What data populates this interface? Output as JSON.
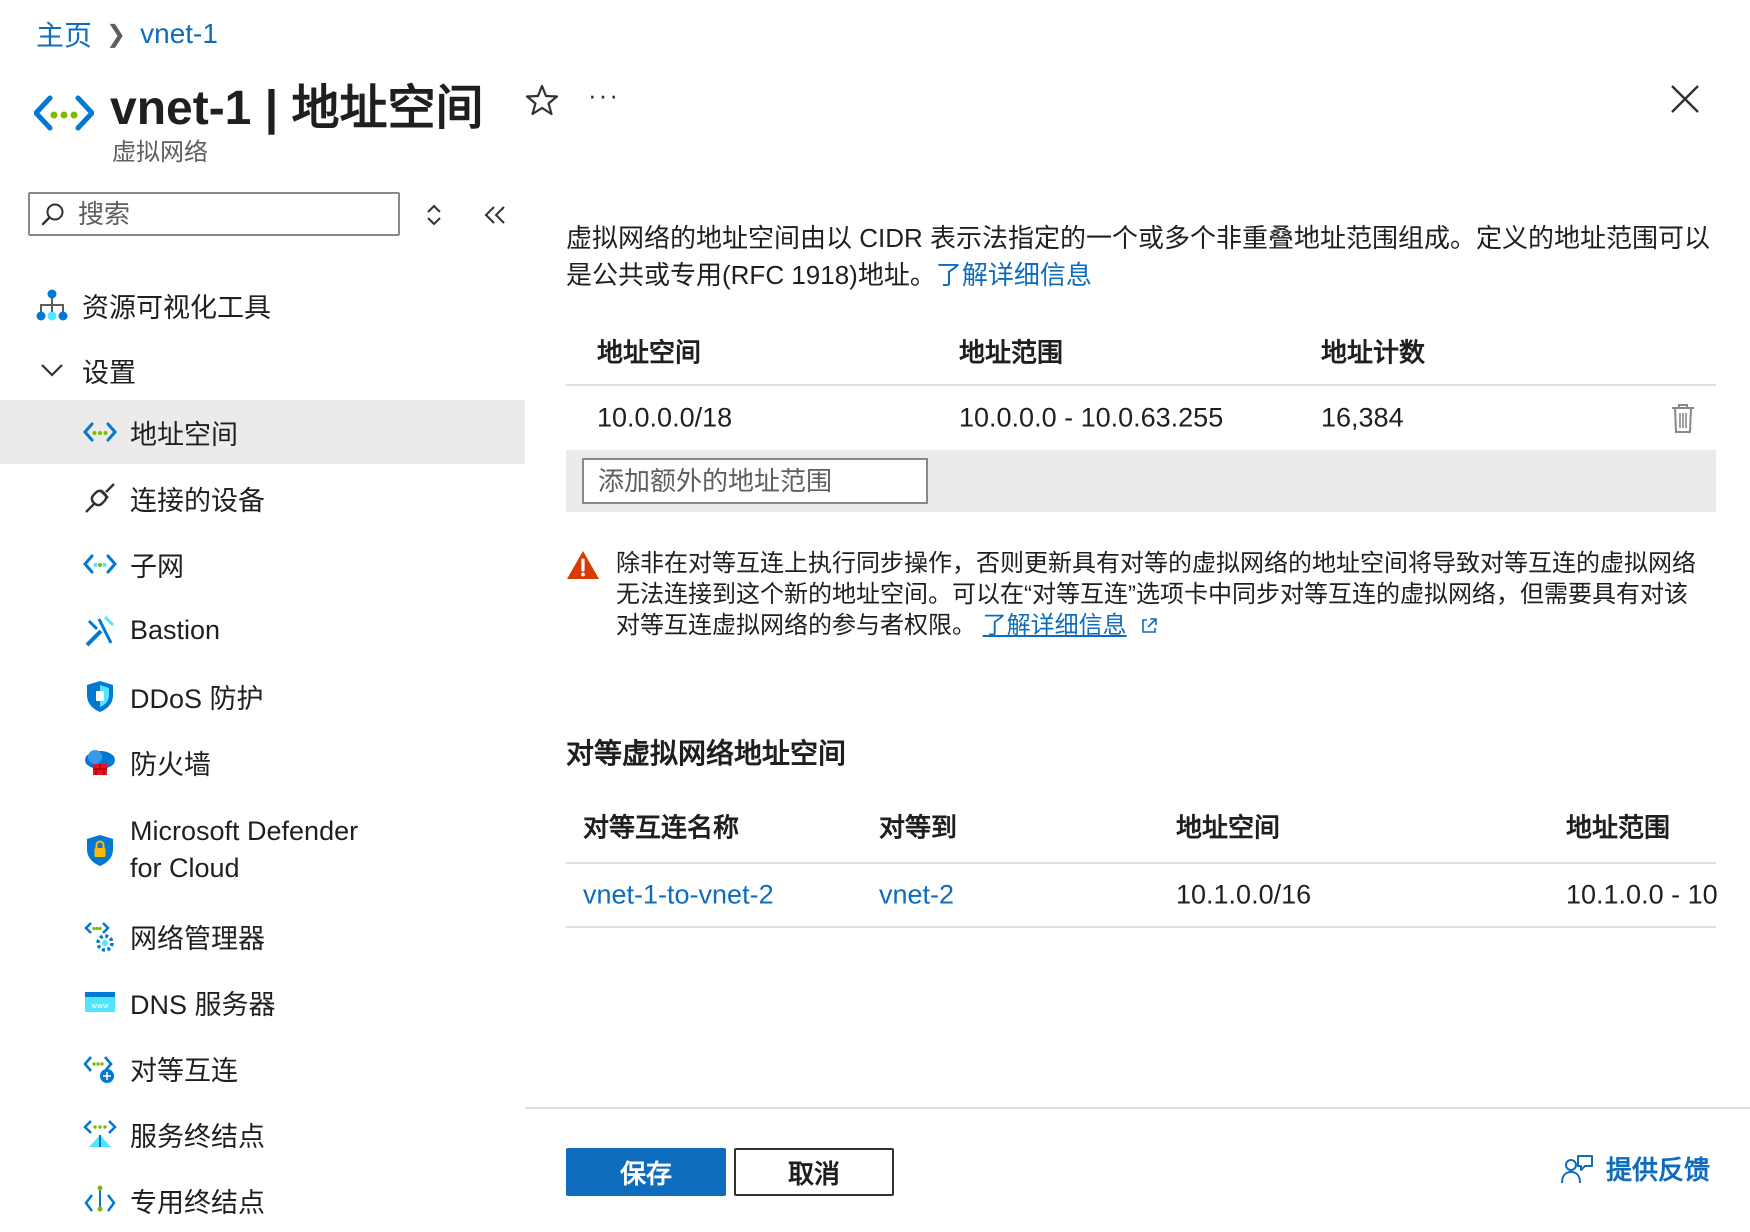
{
  "breadcrumb": {
    "home": "主页",
    "current": "vnet-1"
  },
  "header": {
    "title": "vnet-1 | 地址空间",
    "subtitle": "虚拟网络",
    "more_label": "···"
  },
  "sidebar": {
    "search_placeholder": "搜索",
    "items": [
      {
        "label": "资源可视化工具",
        "icon": "resource-visualizer-icon"
      },
      {
        "label": "设置",
        "icon": "chevron-down-icon"
      },
      {
        "label": "地址空间",
        "icon": "address-space-icon",
        "selected": true
      },
      {
        "label": "连接的设备",
        "icon": "plug-icon"
      },
      {
        "label": "子网",
        "icon": "subnet-icon"
      },
      {
        "label": "Bastion",
        "icon": "bastion-icon"
      },
      {
        "label": "DDoS 防护",
        "icon": "shield-icon"
      },
      {
        "label": "防火墙",
        "icon": "firewall-icon"
      },
      {
        "label_line1": "Microsoft Defender",
        "label_line2": "for Cloud",
        "icon": "defender-shield-icon"
      },
      {
        "label": "网络管理器",
        "icon": "network-manager-icon"
      },
      {
        "label": "DNS 服务器",
        "icon": "dns-icon"
      },
      {
        "label": "对等互连",
        "icon": "peering-icon"
      },
      {
        "label": "服务终结点",
        "icon": "service-endpoint-icon"
      },
      {
        "label": "专用终结点",
        "icon": "private-endpoint-icon"
      }
    ]
  },
  "main": {
    "intro_text": "虚拟网络的地址空间由以 CIDR 表示法指定的一个或多个非重叠地址范围组成。定义的地址范围可以是公共或专用(RFC 1918)地址。",
    "intro_link": "了解详细信息",
    "address_table": {
      "headers": [
        "地址空间",
        "地址范围",
        "地址计数"
      ],
      "rows": [
        {
          "space": "10.0.0.0/18",
          "range": "10.0.0.0 - 10.0.63.255",
          "count": "16,384"
        }
      ],
      "add_placeholder": "添加额外的地址范围"
    },
    "warning": {
      "text": "除非在对等互连上执行同步操作，否则更新具有对等的虚拟网络的地址空间将导致对等互连的虚拟网络无法连接到这个新的地址空间。可以在“对等互连”选项卡中同步对等互连的虚拟网络，但需要具有对该对等互连虚拟网络的参与者权限。",
      "link": "了解详细信息"
    },
    "peered_section_title": "对等虚拟网络地址空间",
    "peered_table": {
      "headers": [
        "对等互连名称",
        "对等到",
        "地址空间",
        "地址范围"
      ],
      "rows": [
        {
          "name": "vnet-1-to-vnet-2",
          "peer": "vnet-2",
          "space": "10.1.0.0/16",
          "range": "10.1.0.0 - 10"
        }
      ]
    }
  },
  "footer": {
    "save_label": "保存",
    "cancel_label": "取消",
    "feedback_label": "提供反馈"
  },
  "colors": {
    "accent": "#0f6cbd",
    "selected_bg": "#edebe9",
    "warning": "#d83b01",
    "text": "#201f1e"
  }
}
